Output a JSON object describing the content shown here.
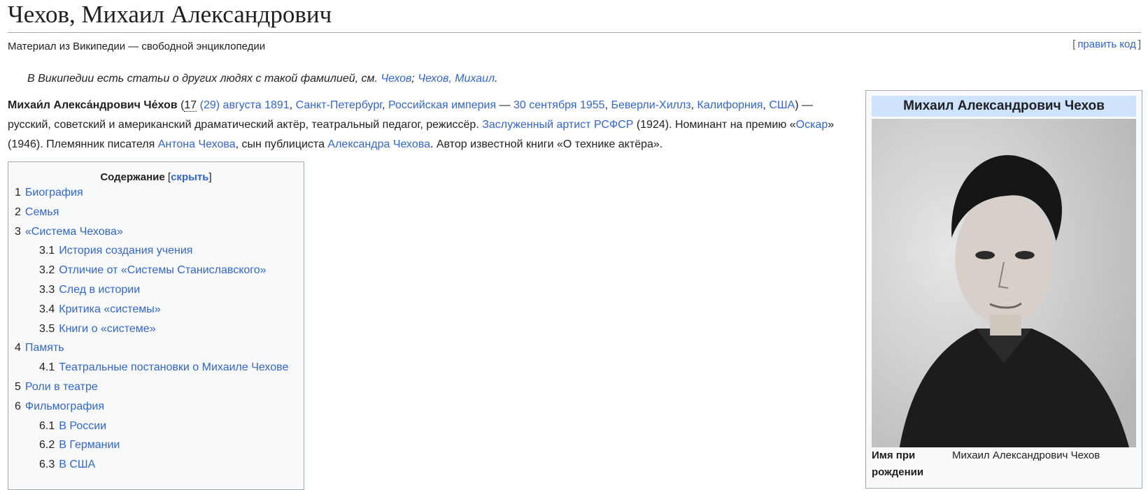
{
  "page": {
    "title": "Чехов, Михаил Александрович",
    "tagline": "Материал из Википедии — свободной энциклопедии",
    "edit": {
      "open": "[",
      "label": "править код",
      "close": "]"
    }
  },
  "hatnote": {
    "prefix": "В Википедии есть статьи о других людях с такой фамилией, см. ",
    "link1": "Чехов",
    "sep": "; ",
    "link2": "Чехов, Михаил",
    "suffix": "."
  },
  "lead": {
    "name": "Михаи́л Алекса́ндрович Че́хов",
    "p1": " (",
    "date_old": "17",
    "birth_date": " (29) августа 1891",
    "c1": ", ",
    "birth_city": "Санкт-Петербург",
    "c2": ", ",
    "birth_country": "Российская империя",
    "dash": " — ",
    "death_date": "30 сентября 1955",
    "c3": ", ",
    "death_city": "Беверли-Хиллз",
    "c4": ", ",
    "death_state": "Калифорния",
    "c5": ", ",
    "death_country": "США",
    "t1": ") — русский, советский и американский драматический актёр, театральный педагог, режиссёр. ",
    "title_link": "Заслуженный артист РСФСР",
    "t2": " (1924). Номинант на премию «",
    "oscar": "Оскар",
    "t3": "» (1946). Племянник писателя ",
    "uncle": "Антона Чехова",
    "t4": ", сын публициста ",
    "father": "Александра Чехова",
    "t5": ". Автор известной книги «О технике актёра»."
  },
  "toc": {
    "title": "Содержание",
    "hide_open": " [",
    "hide": "скрыть",
    "hide_close": "]",
    "items": [
      {
        "num": "1",
        "label": "Биография",
        "level": 1
      },
      {
        "num": "2",
        "label": "Семья",
        "level": 1
      },
      {
        "num": "3",
        "label": "«Система Чехова»",
        "level": 1
      },
      {
        "num": "3.1",
        "label": "История создания учения",
        "level": 2
      },
      {
        "num": "3.2",
        "label": "Отличие от «Системы Станиславского»",
        "level": 2
      },
      {
        "num": "3.3",
        "label": "След в истории",
        "level": 2
      },
      {
        "num": "3.4",
        "label": "Критика «системы»",
        "level": 2
      },
      {
        "num": "3.5",
        "label": "Книги о «системе»",
        "level": 2
      },
      {
        "num": "4",
        "label": "Память",
        "level": 1
      },
      {
        "num": "4.1",
        "label": "Театральные постановки о Михаиле Чехове",
        "level": 2
      },
      {
        "num": "5",
        "label": "Роли в театре",
        "level": 1
      },
      {
        "num": "6",
        "label": "Фильмография",
        "level": 1
      },
      {
        "num": "6.1",
        "label": "В России",
        "level": 2
      },
      {
        "num": "6.2",
        "label": "В Германии",
        "level": 2
      },
      {
        "num": "6.3",
        "label": "В США",
        "level": 2
      }
    ]
  },
  "infobox": {
    "header": "Михаил Александрович Чехов",
    "rows": [
      {
        "label": "Имя при рождении",
        "value": "Михаил Александрович Чехов"
      }
    ]
  }
}
